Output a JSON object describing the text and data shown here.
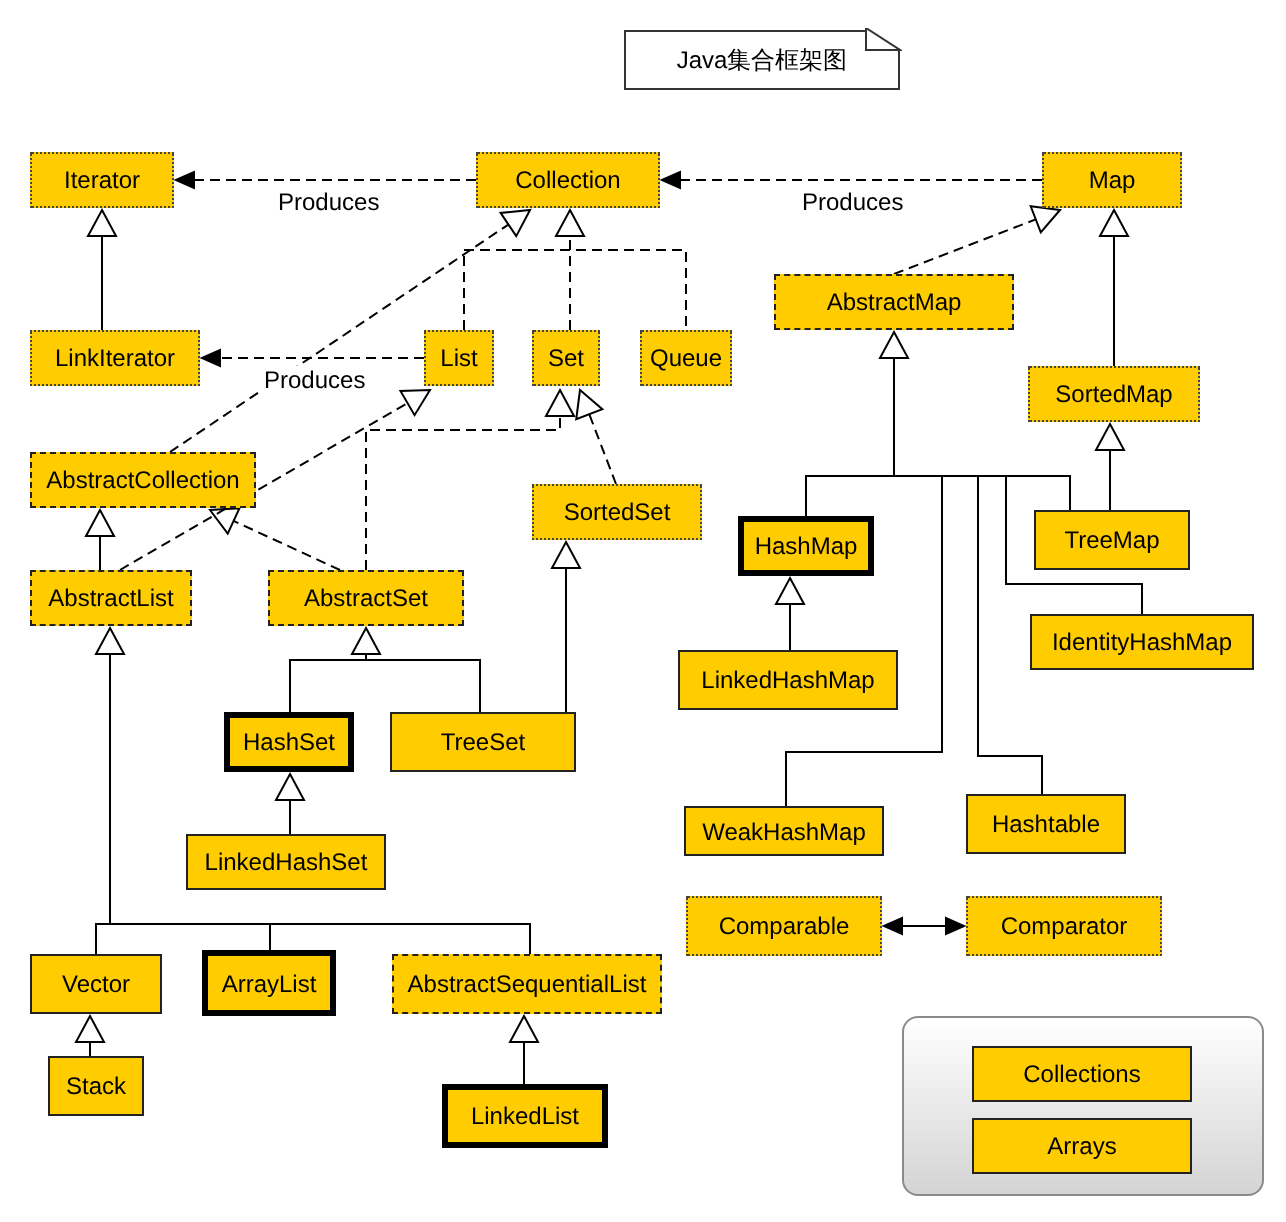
{
  "title": "Java集合框架图",
  "nodes": [
    {
      "label": "Iterator",
      "kind": "interface"
    },
    {
      "label": "Collection",
      "kind": "interface"
    },
    {
      "label": "Map",
      "kind": "interface"
    },
    {
      "label": "LinkIterator",
      "kind": "interface"
    },
    {
      "label": "List",
      "kind": "interface"
    },
    {
      "label": "Set",
      "kind": "interface"
    },
    {
      "label": "Queue",
      "kind": "interface"
    },
    {
      "label": "AbstractMap",
      "kind": "abstract"
    },
    {
      "label": "SortedMap",
      "kind": "interface"
    },
    {
      "label": "AbstractCollection",
      "kind": "abstract"
    },
    {
      "label": "SortedSet",
      "kind": "interface"
    },
    {
      "label": "AbstractList",
      "kind": "abstract"
    },
    {
      "label": "AbstractSet",
      "kind": "abstract"
    },
    {
      "label": "HashMap",
      "kind": "core"
    },
    {
      "label": "TreeMap",
      "kind": "class"
    },
    {
      "label": "LinkedHashMap",
      "kind": "class"
    },
    {
      "label": "IdentityHashMap",
      "kind": "class"
    },
    {
      "label": "HashSet",
      "kind": "core"
    },
    {
      "label": "TreeSet",
      "kind": "class"
    },
    {
      "label": "LinkedHashSet",
      "kind": "class"
    },
    {
      "label": "WeakHashMap",
      "kind": "class"
    },
    {
      "label": "Hashtable",
      "kind": "class"
    },
    {
      "label": "Comparable",
      "kind": "interface"
    },
    {
      "label": "Comparator",
      "kind": "interface"
    },
    {
      "label": "Vector",
      "kind": "class"
    },
    {
      "label": "ArrayList",
      "kind": "core"
    },
    {
      "label": "AbstractSequentialList",
      "kind": "abstract"
    },
    {
      "label": "Stack",
      "kind": "class"
    },
    {
      "label": "LinkedList",
      "kind": "core"
    }
  ],
  "edge_labels": [
    "Produces",
    "Produces",
    "Produces"
  ],
  "legend": {
    "items": [
      {
        "label": "Collections",
        "kind": "class"
      },
      {
        "label": "Arrays",
        "kind": "class"
      }
    ]
  }
}
